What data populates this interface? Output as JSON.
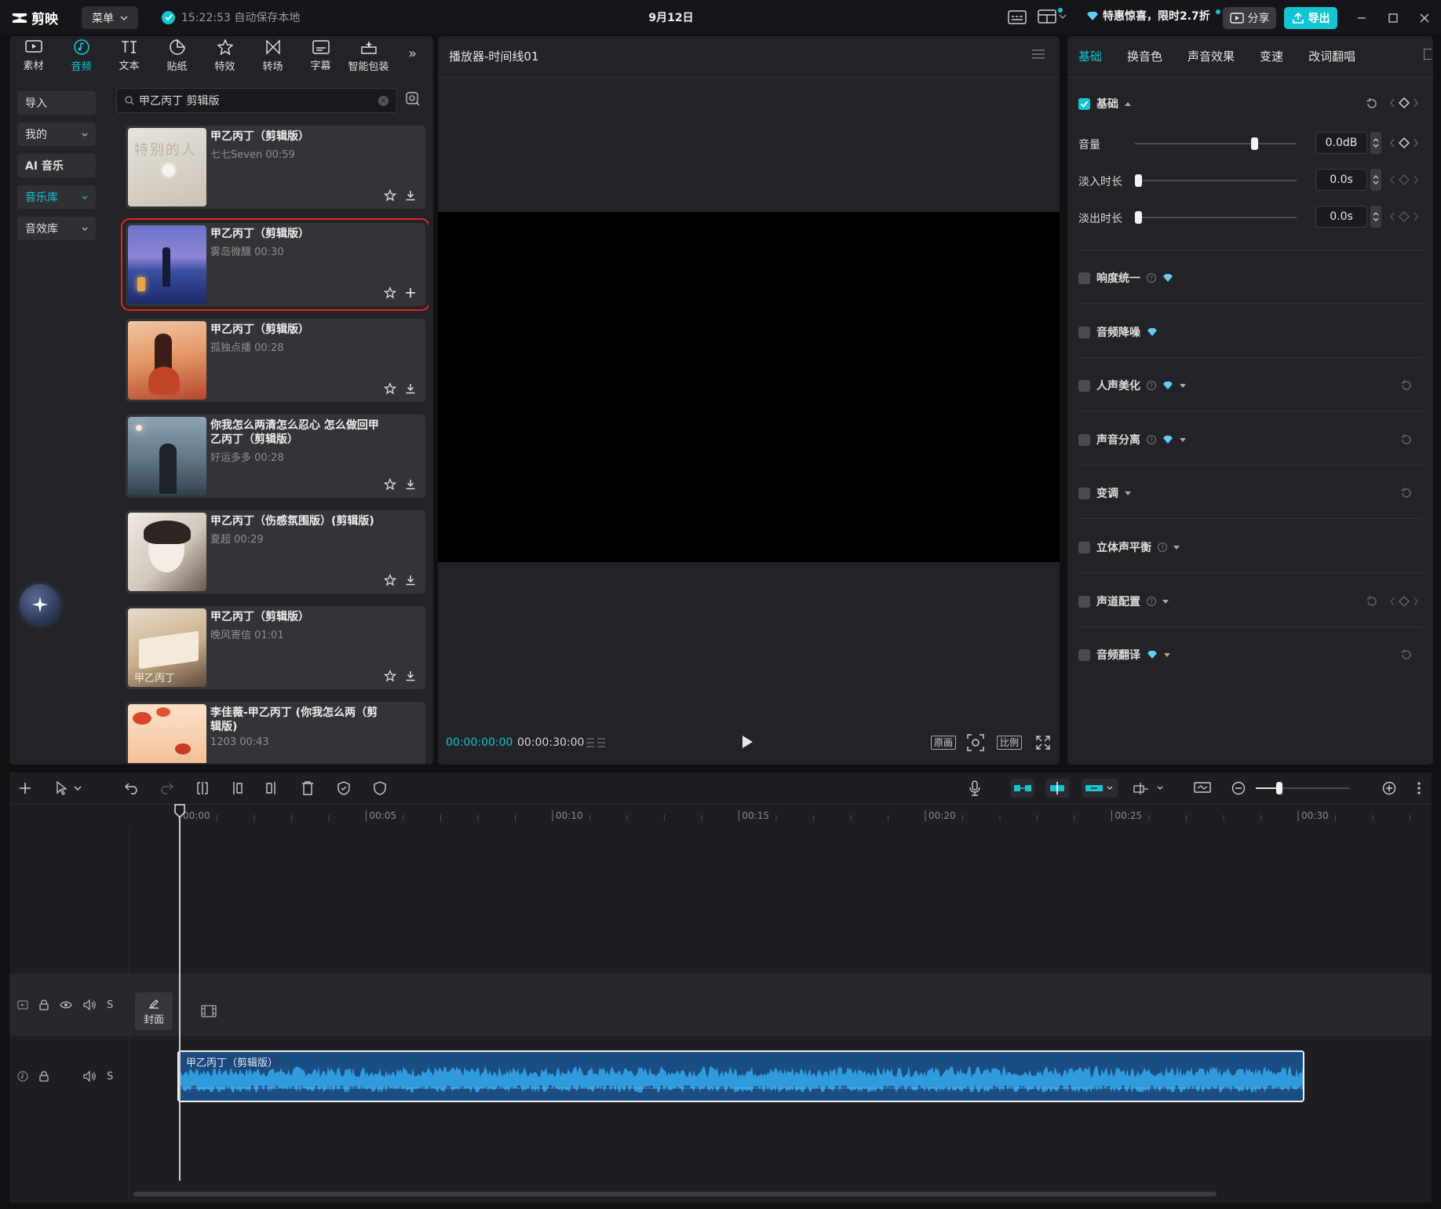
{
  "app": {
    "logo_text": "剪映",
    "menu_label": "菜单",
    "save_status": "15:22:53 自动保存本地",
    "project_title": "9月12日",
    "promo_text": "特惠惊喜，限时2.7折",
    "share_label": "分享",
    "export_label": "导出"
  },
  "left_tabs": [
    {
      "label": "素材",
      "icon": "media-icon"
    },
    {
      "label": "音频",
      "icon": "audio-icon"
    },
    {
      "label": "文本",
      "icon": "text-icon"
    },
    {
      "label": "贴纸",
      "icon": "sticker-icon"
    },
    {
      "label": "特效",
      "icon": "effects-icon"
    },
    {
      "label": "转场",
      "icon": "transition-icon"
    },
    {
      "label": "字幕",
      "icon": "subtitle-icon"
    },
    {
      "label": "智能包装",
      "icon": "smart-pack-icon"
    }
  ],
  "side_categories": [
    {
      "label": "导入"
    },
    {
      "label": "我的"
    },
    {
      "label": "AI 音乐"
    },
    {
      "label": "音乐库"
    },
    {
      "label": "音效库"
    }
  ],
  "search": {
    "value": "甲乙丙丁 剪辑版"
  },
  "songs": [
    {
      "title": "甲乙丙丁（剪辑版）",
      "meta": "七七Seven  00:59",
      "action": "download"
    },
    {
      "title": "甲乙丙丁（剪辑版）",
      "meta": "雾岛微醺  00:30",
      "action": "add"
    },
    {
      "title": "甲乙丙丁（剪辑版）",
      "meta": "孤独点播  00:28",
      "action": "download"
    },
    {
      "title": "你我怎么两清怎么忍心 怎么做回甲乙丙丁（剪辑版）",
      "meta": "好运多多  00:28",
      "action": "download"
    },
    {
      "title": "甲乙丙丁（伤感氛围版）(剪辑版)",
      "meta": "夏超  00:29",
      "action": "download"
    },
    {
      "title": "甲乙丙丁（剪辑版）",
      "meta": "晚风寄信  01:01",
      "action": "download"
    },
    {
      "title": "李佳薇-甲乙丙丁 (你我怎么两（剪辑版)",
      "meta": "1203  00:43",
      "action": "download"
    }
  ],
  "thumb_texts": {
    "song1": "特别的人",
    "song6": "甲乙丙丁"
  },
  "player": {
    "title": "播放器-时间线01",
    "current_time": "00:00:00:00",
    "total_time": "00:00:30:00",
    "original_label": "原画",
    "ratio_label": "比例"
  },
  "right_tabs": [
    {
      "label": "基础"
    },
    {
      "label": "换音色"
    },
    {
      "label": "声音效果"
    },
    {
      "label": "变速"
    },
    {
      "label": "改词翻唱"
    }
  ],
  "basic": {
    "section_label": "基础",
    "volume_label": "音量",
    "volume_value": "0.0dB",
    "volume_level": 0.74,
    "fadein_label": "淡入时长",
    "fadein_value": "0.0s",
    "fadeout_label": "淡出时长",
    "fadeout_value": "0.0s"
  },
  "features": [
    {
      "label": "响度统一",
      "help": true,
      "gem": true,
      "caret": false,
      "reset": false,
      "kf": false
    },
    {
      "label": "音频降噪",
      "help": false,
      "gem": true,
      "caret": false,
      "reset": false,
      "kf": false
    },
    {
      "label": "人声美化",
      "help": true,
      "gem": true,
      "caret": true,
      "reset": true,
      "kf": false
    },
    {
      "label": "声音分离",
      "help": true,
      "gem": true,
      "caret": true,
      "reset": true,
      "kf": false
    },
    {
      "label": "变调",
      "help": false,
      "gem": false,
      "caret": true,
      "reset": true,
      "kf": false
    },
    {
      "label": "立体声平衡",
      "help": true,
      "gem": false,
      "caret": true,
      "reset": false,
      "kf": false
    },
    {
      "label": "声道配置",
      "help": true,
      "gem": false,
      "caret": true,
      "reset": true,
      "kf": true
    },
    {
      "label": "音频翻译",
      "help": false,
      "gem": true,
      "caret": true,
      "reset": true,
      "kf": false
    }
  ],
  "timeline": {
    "ruler_labels": [
      "00:00",
      "00:05",
      "00:10",
      "00:15",
      "00:20",
      "00:25",
      "00:30"
    ],
    "cover_label": "封面",
    "clip_label": "甲乙丙丁（剪辑版）",
    "track_solo": "S"
  },
  "colors": {
    "accent": "#14c4d0",
    "selection": "#e0252b",
    "clip": "#1a4d82",
    "wave": "#2f9bdc"
  }
}
